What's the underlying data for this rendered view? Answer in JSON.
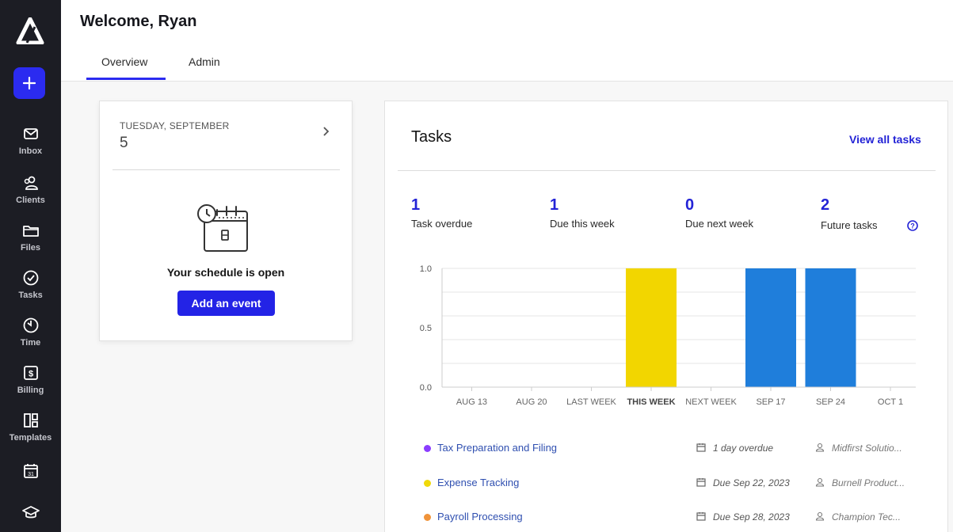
{
  "sidebar": {
    "logo": "app-logo",
    "new_button": "plus-icon",
    "items": [
      {
        "label": "Inbox",
        "icon": "mail-icon"
      },
      {
        "label": "Clients",
        "icon": "clients-icon"
      },
      {
        "label": "Files",
        "icon": "folder-icon"
      },
      {
        "label": "Tasks",
        "icon": "check-circle-icon"
      },
      {
        "label": "Time",
        "icon": "timer-icon"
      },
      {
        "label": "Billing",
        "icon": "dollar-icon"
      },
      {
        "label": "Templates",
        "icon": "templates-icon"
      },
      {
        "label": "",
        "icon": "calendar-icon"
      },
      {
        "label": "",
        "icon": "graduation-cap-icon"
      }
    ]
  },
  "header": {
    "welcome": "Welcome, Ryan",
    "tabs": [
      {
        "label": "Overview",
        "active": true
      },
      {
        "label": "Admin",
        "active": false
      }
    ]
  },
  "calendar": {
    "day_of_week": "TUESDAY, SEPTEMBER",
    "day": "5",
    "empty_message": "Your schedule is open",
    "add_event_label": "Add an event"
  },
  "tasks": {
    "title": "Tasks",
    "view_all_label": "View all tasks",
    "stats": [
      {
        "value": "1",
        "label": "Task overdue"
      },
      {
        "value": "1",
        "label": "Due this week"
      },
      {
        "value": "0",
        "label": "Due next week"
      },
      {
        "value": "2",
        "label": "Future tasks"
      }
    ],
    "list": [
      {
        "name": "Tax Preparation and Filing",
        "color": "#8b3dff",
        "due": "1 day overdue",
        "client": "Midfirst Solutio..."
      },
      {
        "name": "Expense Tracking",
        "color": "#f0d90a",
        "due": "Due Sep 22, 2023",
        "client": "Burnell Product..."
      },
      {
        "name": "Payroll Processing",
        "color": "#f0933a",
        "due": "Due Sep 28, 2023",
        "client": "Champion Tec..."
      }
    ]
  },
  "chart_data": {
    "type": "bar",
    "categories": [
      "AUG 13",
      "AUG 20",
      "LAST WEEK",
      "THIS WEEK",
      "NEXT WEEK",
      "SEP 17",
      "SEP 24",
      "OCT 1"
    ],
    "values": [
      0,
      0,
      0,
      1,
      0,
      1,
      1,
      0
    ],
    "colors": [
      "#1f7edb",
      "#1f7edb",
      "#1f7edb",
      "#f2d600",
      "#1f7edb",
      "#1f7edb",
      "#1f7edb",
      "#1f7edb"
    ],
    "highlight_category": "THIS WEEK",
    "yticks": [
      "0.0",
      "0.5",
      "1.0"
    ],
    "ylim": [
      0,
      1
    ],
    "grid": true
  }
}
